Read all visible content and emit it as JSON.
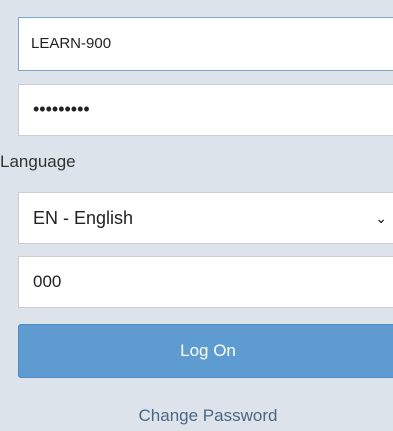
{
  "login": {
    "username_value": "LEARN-900",
    "password_value": "•••••••••",
    "language_label": "Language",
    "language_selected": "EN - English",
    "client_value": "000",
    "logon_label": "Log On",
    "change_password_label": "Change Password"
  },
  "colors": {
    "background": "#dde3ea",
    "primary_button": "#5e9bd1",
    "link": "#4a6883"
  },
  "icons": {
    "select_chevron": "chevron-down-icon"
  }
}
